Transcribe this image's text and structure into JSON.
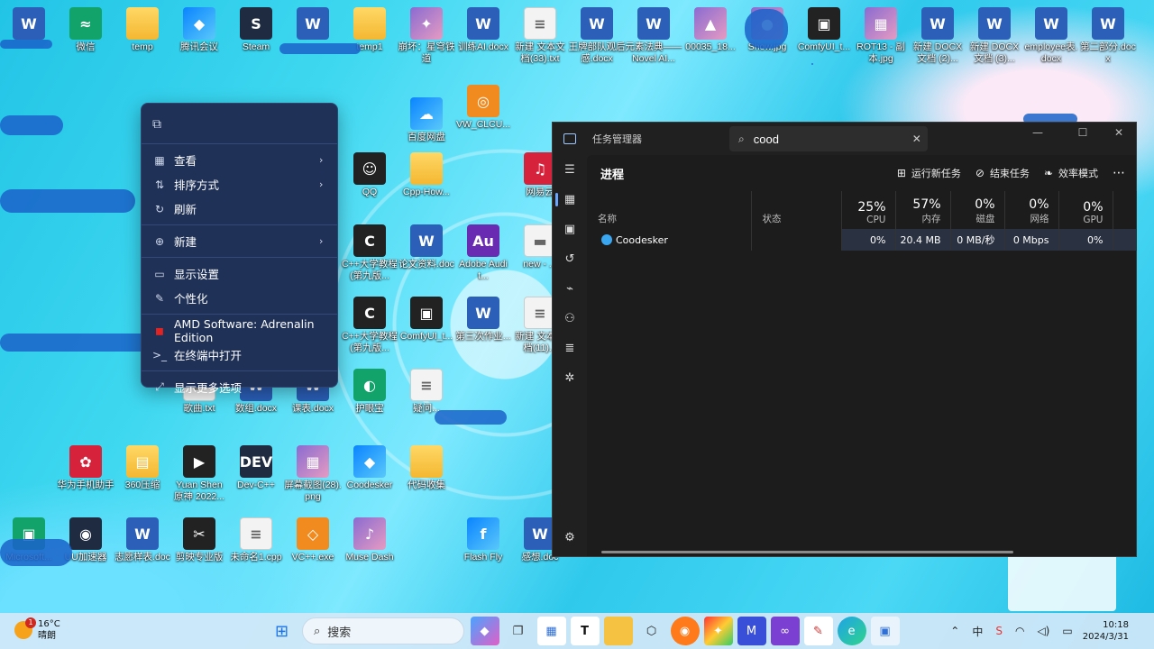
{
  "desktop": {
    "icons": [
      {
        "label": "",
        "glyph": "W",
        "kind": "word"
      },
      {
        "label": "微信",
        "glyph": "≈",
        "kind": "green"
      },
      {
        "label": "temp",
        "glyph": "",
        "kind": "folder"
      },
      {
        "label": "腾讯会议",
        "glyph": "◆",
        "kind": "misc"
      },
      {
        "label": "Steam",
        "glyph": "S",
        "kind": "app"
      },
      {
        "label": "",
        "glyph": "W",
        "kind": "word"
      },
      {
        "label": "temp1",
        "glyph": "",
        "kind": "folder"
      },
      {
        "label": "崩坏：星穹铁道",
        "glyph": "✦",
        "kind": "img"
      },
      {
        "label": "训练AI.docx",
        "glyph": "W",
        "kind": "word"
      },
      {
        "label": "新建 文本文档(33).txt",
        "glyph": "≡",
        "kind": "txt"
      },
      {
        "label": "王牌部队观后感.docx",
        "glyph": "W",
        "kind": "word"
      },
      {
        "label": "元素法典——Novel AI...",
        "glyph": "W",
        "kind": "word"
      },
      {
        "label": "00035_18...",
        "glyph": "▲",
        "kind": "img"
      },
      {
        "label": "Show.jpg",
        "glyph": "●",
        "kind": "img"
      },
      {
        "label": "ComfyUI_t...",
        "glyph": "▣",
        "kind": "dark"
      },
      {
        "label": "ROT13 - 副本.jpg",
        "glyph": "▦",
        "kind": "img"
      },
      {
        "label": "新建 DOCX 文档 (2)...",
        "glyph": "W",
        "kind": "word"
      },
      {
        "label": "新建 DOCX 文档 (3)...",
        "glyph": "W",
        "kind": "word"
      },
      {
        "label": "employee表.docx",
        "glyph": "W",
        "kind": "word"
      },
      {
        "label": "第二部分.docx",
        "glyph": "W",
        "kind": "word"
      },
      {
        "label": "百度网盘",
        "glyph": "☁",
        "kind": "misc"
      },
      {
        "label": "VW_CLCU...",
        "glyph": "◎",
        "kind": "orange"
      },
      {
        "label": "QQ",
        "glyph": "☺",
        "kind": "dark"
      },
      {
        "label": "Cpp-How...",
        "glyph": "",
        "kind": "folder"
      },
      {
        "label": "网易云",
        "glyph": "♫",
        "kind": "red"
      },
      {
        "label": "C++大学教程(第九版...",
        "glyph": "C",
        "kind": "dark"
      },
      {
        "label": "论文资料.doc",
        "glyph": "W",
        "kind": "word"
      },
      {
        "label": "Adobe Audit...",
        "glyph": "Au",
        "kind": "purple"
      },
      {
        "label": "new - ...",
        "glyph": "▬",
        "kind": "txt"
      },
      {
        "label": "C++大学教程(第九版...",
        "glyph": "C",
        "kind": "dark"
      },
      {
        "label": "ComfyUI_t...",
        "glyph": "▣",
        "kind": "dark"
      },
      {
        "label": "第三次作业...",
        "glyph": "W",
        "kind": "word"
      },
      {
        "label": "新建 文本文档(11)...",
        "glyph": "≡",
        "kind": "txt"
      },
      {
        "label": "歌曲.txt",
        "glyph": "≡",
        "kind": "txt"
      },
      {
        "label": "数组.docx",
        "glyph": "W",
        "kind": "word"
      },
      {
        "label": "课表.docx",
        "glyph": "W",
        "kind": "word"
      },
      {
        "label": "护眼宝",
        "glyph": "◐",
        "kind": "green"
      },
      {
        "label": "疑问...",
        "glyph": "≡",
        "kind": "txt"
      },
      {
        "label": "Yuan Shen 原神 2022...",
        "glyph": "▶",
        "kind": "dark"
      },
      {
        "label": "Dev-C++",
        "glyph": "DEV",
        "kind": "app"
      },
      {
        "label": "屏幕截图(28).png",
        "glyph": "▦",
        "kind": "img"
      },
      {
        "label": "Coodesker",
        "glyph": "◆",
        "kind": "misc"
      },
      {
        "label": "代码收集",
        "glyph": "",
        "kind": "folder"
      },
      {
        "label": "360压缩",
        "glyph": "▤",
        "kind": "folder"
      },
      {
        "label": "华为手机助手",
        "glyph": "✿",
        "kind": "red"
      },
      {
        "label": "剪映专业版",
        "glyph": "✂",
        "kind": "dark"
      },
      {
        "label": "未命名1.cpp",
        "glyph": "≡",
        "kind": "txt"
      },
      {
        "label": "VC++.exe",
        "glyph": "◇",
        "kind": "orange"
      },
      {
        "label": "Muse Dash",
        "glyph": "♪",
        "kind": "img"
      },
      {
        "label": "Flash Fly",
        "glyph": "f",
        "kind": "misc"
      },
      {
        "label": "UU加速器",
        "glyph": "◉",
        "kind": "app"
      },
      {
        "label": "志愿样表.doc",
        "glyph": "W",
        "kind": "word"
      },
      {
        "label": "感想.doc",
        "glyph": "W",
        "kind": "word"
      },
      {
        "label": "Microsoft...",
        "glyph": "▣",
        "kind": "green"
      }
    ]
  },
  "context_menu": {
    "top_icon": "clipboard-icon",
    "items": [
      {
        "icon": "grid-icon",
        "glyph": "▦",
        "label": "查看",
        "submenu": true
      },
      {
        "icon": "sort-icon",
        "glyph": "⇅",
        "label": "排序方式",
        "submenu": true
      },
      {
        "icon": "refresh-icon",
        "glyph": "↻",
        "label": "刷新",
        "submenu": false
      },
      {
        "icon": "new-icon",
        "glyph": "⊕",
        "label": "新建",
        "submenu": true
      },
      {
        "icon": "display-icon",
        "glyph": "▭",
        "label": "显示设置",
        "submenu": false
      },
      {
        "icon": "brush-icon",
        "glyph": "✎",
        "label": "个性化",
        "submenu": false
      },
      {
        "icon": "amd-icon",
        "glyph": "◼",
        "label": "AMD Software: Adrenalin Edition",
        "submenu": false
      },
      {
        "icon": "terminal-icon",
        "glyph": ">_",
        "label": "在终端中打开",
        "submenu": false
      },
      {
        "icon": "more-options-icon",
        "glyph": "⤢",
        "label": "显示更多选项",
        "submenu": false
      }
    ]
  },
  "task_manager": {
    "title": "任务管理器",
    "search_value": "cood",
    "page_title": "进程",
    "actions": {
      "run_new_task": "运行新任务",
      "end_task": "结束任务",
      "efficiency_mode": "效率模式"
    },
    "columns": {
      "name": "名称",
      "status": "状态",
      "cpu": {
        "pct": "25%",
        "label": "CPU"
      },
      "memory": {
        "pct": "57%",
        "label": "内存"
      },
      "disk": {
        "pct": "0%",
        "label": "磁盘"
      },
      "network": {
        "pct": "0%",
        "label": "网络"
      },
      "gpu": {
        "pct": "0%",
        "label": "GPU"
      }
    },
    "rows": [
      {
        "name": "Coodesker",
        "status": "",
        "cpu": "0%",
        "memory": "20.4 MB",
        "disk": "0 MB/秒",
        "network": "0 Mbps",
        "gpu": "0%"
      }
    ]
  },
  "taskbar": {
    "weather": {
      "temp": "16°C",
      "condition": "晴朗",
      "badge": "1"
    },
    "search_placeholder": "搜索",
    "ime_label": "中",
    "clock": {
      "time": "10:18",
      "date": "2024/3/31"
    }
  },
  "colors": {
    "accent": "#6aa5ff",
    "context_menu_bg": "#1f3156",
    "task_manager_bg": "#202020"
  }
}
